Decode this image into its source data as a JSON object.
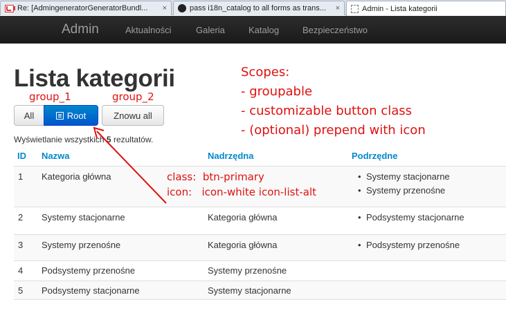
{
  "browser": {
    "tabs": [
      {
        "title": "Re: [AdmingeneratorGeneratorBundl...",
        "icon": "gmail-icon",
        "active": false
      },
      {
        "title": "pass i18n_catalog to all forms as trans...",
        "icon": "github-icon",
        "active": false
      },
      {
        "title": "Admin - Lista kategorii",
        "icon": "blank-page-icon",
        "active": true
      }
    ],
    "close_glyph": "×"
  },
  "navbar": {
    "brand": "Admin",
    "items": [
      "Aktualności",
      "Galeria",
      "Katalog",
      "Bezpieczeństwo"
    ]
  },
  "page": {
    "title": "Lista kategorii",
    "scope_buttons": {
      "all": "All",
      "root": "Root",
      "reset": "Znowu all"
    },
    "results": {
      "prefix": "Wyświetlanie wszystkich ",
      "count": "5",
      "suffix": " rezultatów."
    }
  },
  "table": {
    "headers": [
      "ID",
      "Nazwa",
      "Nadrzędna",
      "Podrzędne"
    ],
    "rows": [
      {
        "id": "1",
        "name": "Kategoria główna",
        "parent": "",
        "children": [
          "Systemy stacjonarne",
          "Systemy przenośne"
        ]
      },
      {
        "id": "2",
        "name": "Systemy stacjonarne",
        "parent": "Kategoria główna",
        "children": [
          "Podsystemy stacjonarne"
        ]
      },
      {
        "id": "3",
        "name": "Systemy przenośne",
        "parent": "Kategoria główna",
        "children": [
          "Podsystemy przenośne"
        ]
      },
      {
        "id": "4",
        "name": "Podsystemy przenośne",
        "parent": "Systemy przenośne",
        "children": []
      },
      {
        "id": "5",
        "name": "Podsystemy stacjonarne",
        "parent": "Systemy stacjonarne",
        "children": []
      }
    ]
  },
  "annotations": {
    "group_1": "group_1",
    "group_2": "group_2",
    "scopes_lines": [
      "Scopes:",
      "- groupable",
      "- customizable button class",
      "- (optional) prepend with icon"
    ],
    "class_label": "class:",
    "class_value": "btn-primary",
    "icon_label": "icon:",
    "icon_value": "icon-white icon-list-alt",
    "color": "#e01010"
  },
  "colors": {
    "navbar": "#1b1b1b",
    "link": "#0088cc",
    "primary_button": "#0066cc"
  }
}
